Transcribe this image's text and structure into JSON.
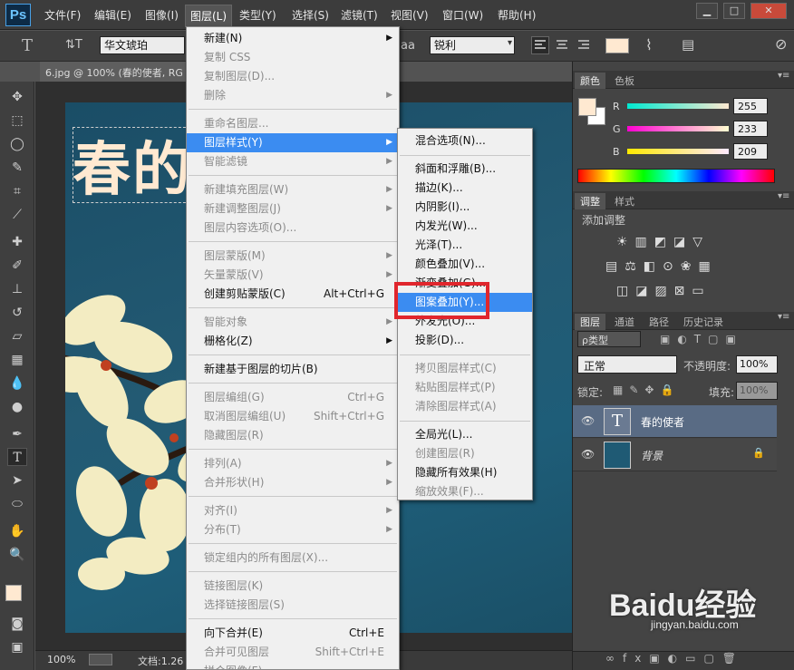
{
  "menubar": {
    "logo": "Ps",
    "items": [
      "文件(F)",
      "编辑(E)",
      "图像(I)",
      "图层(L)",
      "类型(Y)",
      "选择(S)",
      "滤镜(T)",
      "视图(V)",
      "窗口(W)",
      "帮助(H)"
    ],
    "active_index": 3,
    "window_buttons": [
      "▁",
      "□",
      "✕"
    ]
  },
  "options": {
    "tool_glyph": "T",
    "orient_glyph": "⇅T",
    "font_family": "华文琥珀",
    "aa_label": "aa",
    "antialias": "锐利"
  },
  "document": {
    "tab_title": "6.jpg @ 100% (春的使者, RG",
    "canvas_text": "春的",
    "zoom": "100%",
    "doc_info": "文档:1.26"
  },
  "layer_menu": {
    "items": [
      {
        "label": "新建(N)",
        "disabled": false,
        "submenu": true,
        "shortcut": ""
      },
      {
        "label": "复制 CSS",
        "disabled": true,
        "submenu": false,
        "shortcut": ""
      },
      {
        "label": "复制图层(D)...",
        "disabled": true,
        "submenu": false,
        "shortcut": ""
      },
      {
        "label": "删除",
        "disabled": true,
        "submenu": true,
        "shortcut": ""
      },
      {
        "label": "重命名图层...",
        "disabled": true,
        "submenu": false,
        "shortcut": ""
      },
      {
        "label": "图层样式(Y)",
        "disabled": false,
        "submenu": true,
        "shortcut": "",
        "highlight": true
      },
      {
        "label": "智能滤镜",
        "disabled": true,
        "submenu": true,
        "shortcut": ""
      },
      {
        "label": "新建填充图层(W)",
        "disabled": true,
        "submenu": true,
        "shortcut": ""
      },
      {
        "label": "新建调整图层(J)",
        "disabled": true,
        "submenu": true,
        "shortcut": ""
      },
      {
        "label": "图层内容选项(O)...",
        "disabled": true,
        "submenu": false,
        "shortcut": ""
      },
      {
        "label": "图层蒙版(M)",
        "disabled": true,
        "submenu": true,
        "shortcut": ""
      },
      {
        "label": "矢量蒙版(V)",
        "disabled": true,
        "submenu": true,
        "shortcut": ""
      },
      {
        "label": "创建剪贴蒙版(C)",
        "disabled": false,
        "submenu": false,
        "shortcut": "Alt+Ctrl+G"
      },
      {
        "label": "智能对象",
        "disabled": true,
        "submenu": true,
        "shortcut": ""
      },
      {
        "label": "栅格化(Z)",
        "disabled": false,
        "submenu": true,
        "shortcut": ""
      },
      {
        "label": "新建基于图层的切片(B)",
        "disabled": false,
        "submenu": false,
        "shortcut": ""
      },
      {
        "label": "图层编组(G)",
        "disabled": true,
        "submenu": false,
        "shortcut": "Ctrl+G"
      },
      {
        "label": "取消图层编组(U)",
        "disabled": true,
        "submenu": false,
        "shortcut": "Shift+Ctrl+G"
      },
      {
        "label": "隐藏图层(R)",
        "disabled": true,
        "submenu": false,
        "shortcut": ""
      },
      {
        "label": "排列(A)",
        "disabled": true,
        "submenu": true,
        "shortcut": ""
      },
      {
        "label": "合并形状(H)",
        "disabled": true,
        "submenu": true,
        "shortcut": ""
      },
      {
        "label": "对齐(I)",
        "disabled": true,
        "submenu": true,
        "shortcut": ""
      },
      {
        "label": "分布(T)",
        "disabled": true,
        "submenu": true,
        "shortcut": ""
      },
      {
        "label": "锁定组内的所有图层(X)...",
        "disabled": true,
        "submenu": false,
        "shortcut": ""
      },
      {
        "label": "链接图层(K)",
        "disabled": true,
        "submenu": false,
        "shortcut": ""
      },
      {
        "label": "选择链接图层(S)",
        "disabled": true,
        "submenu": false,
        "shortcut": ""
      },
      {
        "label": "向下合并(E)",
        "disabled": false,
        "submenu": false,
        "shortcut": "Ctrl+E"
      },
      {
        "label": "合并可见图层",
        "disabled": true,
        "submenu": false,
        "shortcut": "Shift+Ctrl+E"
      },
      {
        "label": "拼合图像(F)",
        "disabled": true,
        "submenu": false,
        "shortcut": ""
      }
    ]
  },
  "style_submenu": {
    "items": [
      {
        "label": "混合选项(N)...",
        "disabled": false
      },
      {
        "label": "斜面和浮雕(B)...",
        "disabled": false
      },
      {
        "label": "描边(K)...",
        "disabled": false
      },
      {
        "label": "内阴影(I)...",
        "disabled": false
      },
      {
        "label": "内发光(W)...",
        "disabled": false
      },
      {
        "label": "光泽(T)...",
        "disabled": false
      },
      {
        "label": "颜色叠加(V)...",
        "disabled": false
      },
      {
        "label": "渐变叠加(G)...",
        "disabled": false
      },
      {
        "label": "图案叠加(Y)...",
        "disabled": false,
        "highlight": true
      },
      {
        "label": "外发光(O)...",
        "disabled": false
      },
      {
        "label": "投影(D)...",
        "disabled": false
      },
      {
        "label": "拷贝图层样式(C)",
        "disabled": true
      },
      {
        "label": "粘贴图层样式(P)",
        "disabled": true
      },
      {
        "label": "清除图层样式(A)",
        "disabled": true
      },
      {
        "label": "全局光(L)...",
        "disabled": false
      },
      {
        "label": "创建图层(R)",
        "disabled": true
      },
      {
        "label": "隐藏所有效果(H)",
        "disabled": false
      },
      {
        "label": "缩放效果(F)...",
        "disabled": true
      }
    ]
  },
  "color_panel": {
    "tabs": [
      "颜色",
      "色板"
    ],
    "channels": [
      {
        "name": "R",
        "value": "255"
      },
      {
        "name": "G",
        "value": "233"
      },
      {
        "name": "B",
        "value": "209"
      }
    ],
    "foreground": "#ffe9d1"
  },
  "adjust_panel": {
    "tabs": [
      "调整",
      "样式"
    ],
    "title": "添加调整"
  },
  "layers_panel": {
    "tabs": [
      "图层",
      "通道",
      "路径",
      "历史记录"
    ],
    "filter": "ρ类型",
    "blend_mode": "正常",
    "opacity_label": "不透明度:",
    "opacity": "100%",
    "lock_label": "锁定:",
    "fill_label": "填充:",
    "fill": "100%",
    "layers": [
      {
        "name": "春的使者",
        "type": "text",
        "selected": true
      },
      {
        "name": "背景",
        "type": "image",
        "locked": true
      }
    ]
  },
  "watermark": {
    "text": "Baidu经验",
    "url": "jingyan.baidu.com"
  },
  "colors": {
    "menu_highlight": "#3b8cf1",
    "callout": "#e0262d",
    "canvas_bg": "#1f5a74"
  }
}
